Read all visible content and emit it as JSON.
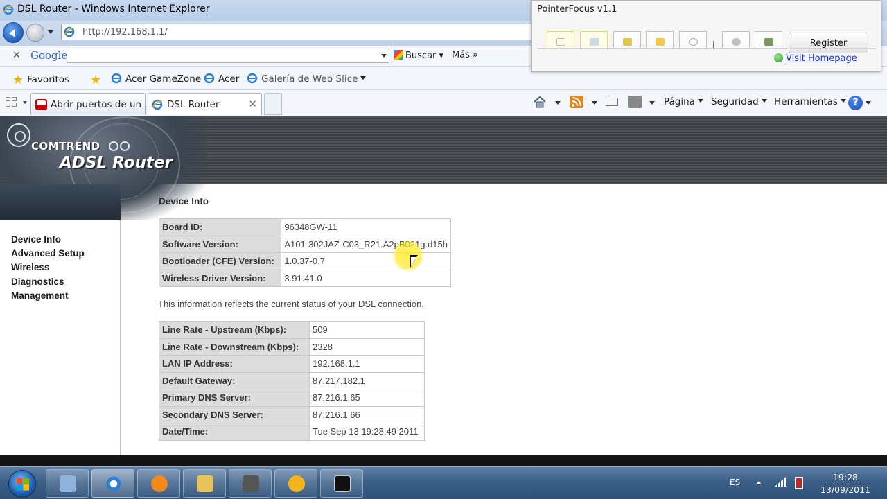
{
  "window": {
    "title": "DSL Router - Windows Internet Explorer",
    "address": "http://192.168.1.1/"
  },
  "google_bar": {
    "logo": "Google",
    "search_value": "",
    "buscar_label": "Buscar",
    "mas_label": "Más »"
  },
  "favorites": {
    "favoritos_label": "Favoritos",
    "items": [
      "Acer GameZone",
      "Acer",
      "Galería de Web Slice"
    ]
  },
  "tabs": [
    {
      "label": "Abrir puertos de un ...",
      "icon": "youtube-icon"
    },
    {
      "label": "DSL Router",
      "icon": "ie-icon",
      "active": true
    }
  ],
  "command_bar": {
    "pagina": "Página",
    "seguridad": "Seguridad",
    "herramientas": "Herramientas",
    "help": "?"
  },
  "pointerfocus": {
    "title": "PointerFocus v1.1",
    "register_label": "Register",
    "visit_label": "Visit Homepage"
  },
  "router": {
    "brand": "COMTREND",
    "product": "ADSL Router",
    "menu": [
      "Device Info",
      "Advanced Setup",
      "Wireless",
      "Diagnostics",
      "Management"
    ],
    "section_title": "Device Info",
    "device_table": [
      {
        "key": "Board ID:",
        "value": "96348GW-11"
      },
      {
        "key": "Software Version:",
        "value": "A101-302JAZ-C03_R21.A2pB021g.d15h"
      },
      {
        "key": "Bootloader (CFE) Version:",
        "value": "1.0.37-0.7"
      },
      {
        "key": "Wireless Driver Version:",
        "value": "3.91.41.0"
      }
    ],
    "info_text": "This information reflects the current status of your DSL connection.",
    "status_table": [
      {
        "key": "Line Rate - Upstream (Kbps):",
        "value": "509"
      },
      {
        "key": "Line Rate - Downstream (Kbps):",
        "value": "2328"
      },
      {
        "key": "LAN IP Address:",
        "value": "192.168.1.1"
      },
      {
        "key": "Default Gateway:",
        "value": "87.217.182.1"
      },
      {
        "key": "Primary DNS Server:",
        "value": "87.216.1.65"
      },
      {
        "key": "Secondary DNS Server:",
        "value": "87.216.1.66"
      },
      {
        "key": "Date/Time:",
        "value": "Tue Sep 13 19:28:49 2011"
      }
    ]
  },
  "taskbar": {
    "language": "ES",
    "time": "19:28",
    "date": "13/09/2011"
  },
  "colors": {
    "ie_blue": "#1f5fbf",
    "table_key_bg": "#dcdcdc",
    "link_blue": "#1a2fdc",
    "pointer_highlight": "#ffeb28"
  }
}
